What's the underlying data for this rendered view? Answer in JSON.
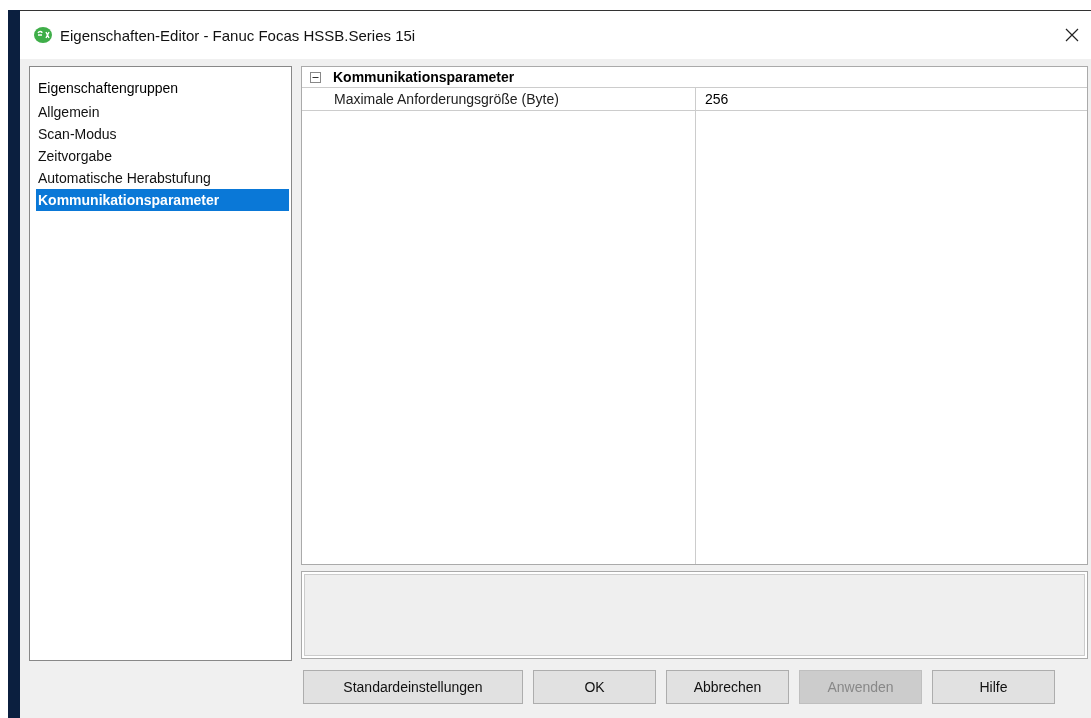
{
  "window": {
    "title": "Eigenschaften-Editor - Fanuc Focas HSSB.Series 15i"
  },
  "groups": {
    "heading": "Eigenschaftengruppen",
    "items": [
      {
        "label": "Allgemein",
        "selected": false
      },
      {
        "label": "Scan-Modus",
        "selected": false
      },
      {
        "label": "Zeitvorgabe",
        "selected": false
      },
      {
        "label": "Automatische Herabstufung",
        "selected": false
      },
      {
        "label": "Kommunikationsparameter",
        "selected": true
      }
    ]
  },
  "grid": {
    "categories": [
      {
        "label": "Kommunikationsparameter",
        "expanded": true,
        "properties": [
          {
            "name": "Maximale Anforderungsgröße (Byte)",
            "value": "256"
          }
        ]
      }
    ]
  },
  "buttons": [
    {
      "label": "Standardeinstellungen",
      "disabled": false
    },
    {
      "label": "OK",
      "disabled": false
    },
    {
      "label": "Abbrechen",
      "disabled": false
    },
    {
      "label": "Anwenden",
      "disabled": true
    },
    {
      "label": "Hilfe",
      "disabled": false
    }
  ]
}
